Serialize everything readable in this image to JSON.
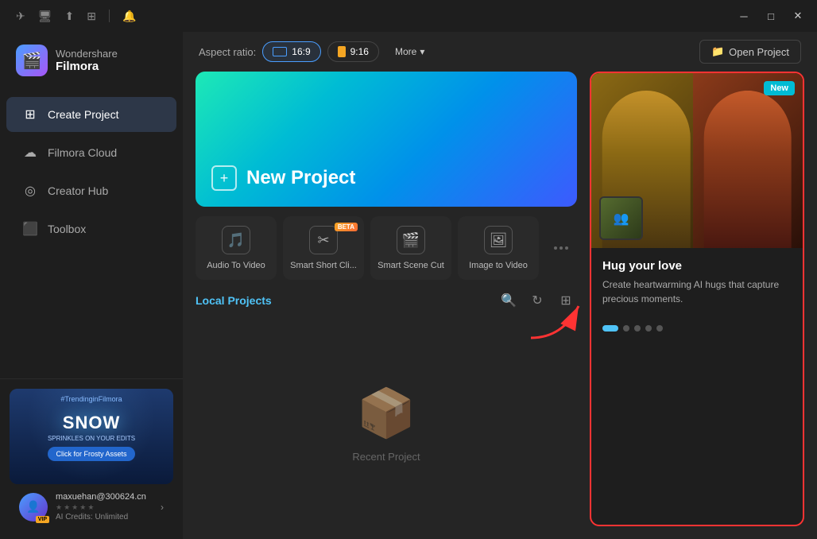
{
  "window": {
    "title": "Wondershare Filmora"
  },
  "titlebar": {
    "icons": [
      "share",
      "screen",
      "cloud",
      "grid",
      "bell"
    ],
    "controls": [
      "minimize",
      "maximize",
      "close"
    ]
  },
  "logo": {
    "brand": "Wondershare",
    "product": "Filmora"
  },
  "sidebar": {
    "items": [
      {
        "id": "create-project",
        "label": "Create Project",
        "icon": "➕",
        "active": true
      },
      {
        "id": "filmora-cloud",
        "label": "Filmora Cloud",
        "icon": "☁️",
        "active": false
      },
      {
        "id": "creator-hub",
        "label": "Creator Hub",
        "icon": "🎯",
        "active": false
      },
      {
        "id": "toolbox",
        "label": "Toolbox",
        "icon": "🧰",
        "active": false
      }
    ]
  },
  "promo": {
    "hashtag": "#TrendinginFilmora",
    "main_text": "SNOW",
    "subtitle": "SPRINKLES ON YOUR EDITS",
    "button": "Click for Frosty Assets"
  },
  "user": {
    "email": "maxuehan@300624.cn",
    "credits": "AI Credits: Unlimited",
    "badge": "VIP"
  },
  "toolbar": {
    "aspect_label": "Aspect ratio:",
    "ratio_16_9": "16:9",
    "ratio_9_16": "9:16",
    "more_label": "More",
    "open_project_label": "Open Project"
  },
  "new_project": {
    "label": "New Project",
    "icon": "+"
  },
  "tools": [
    {
      "id": "audio-to-video",
      "label": "Audio To Video",
      "icon": "🎵",
      "beta": false
    },
    {
      "id": "smart-short-cli",
      "label": "Smart Short Cli...",
      "icon": "✂️",
      "beta": true
    },
    {
      "id": "smart-scene-cut",
      "label": "Smart Scene Cut",
      "icon": "🎬",
      "beta": false
    },
    {
      "id": "image-to-video",
      "label": "Image to Video",
      "icon": "🖼️",
      "beta": false
    }
  ],
  "local_projects": {
    "title": "Local Projects",
    "empty_label": "Recent Project"
  },
  "featured": {
    "new_badge": "New",
    "title": "Hug your love",
    "description": "Create heartwarming AI hugs that capture precious moments.",
    "dots": [
      {
        "active": true
      },
      {
        "active": false
      },
      {
        "active": false
      },
      {
        "active": false
      },
      {
        "active": false
      }
    ]
  }
}
